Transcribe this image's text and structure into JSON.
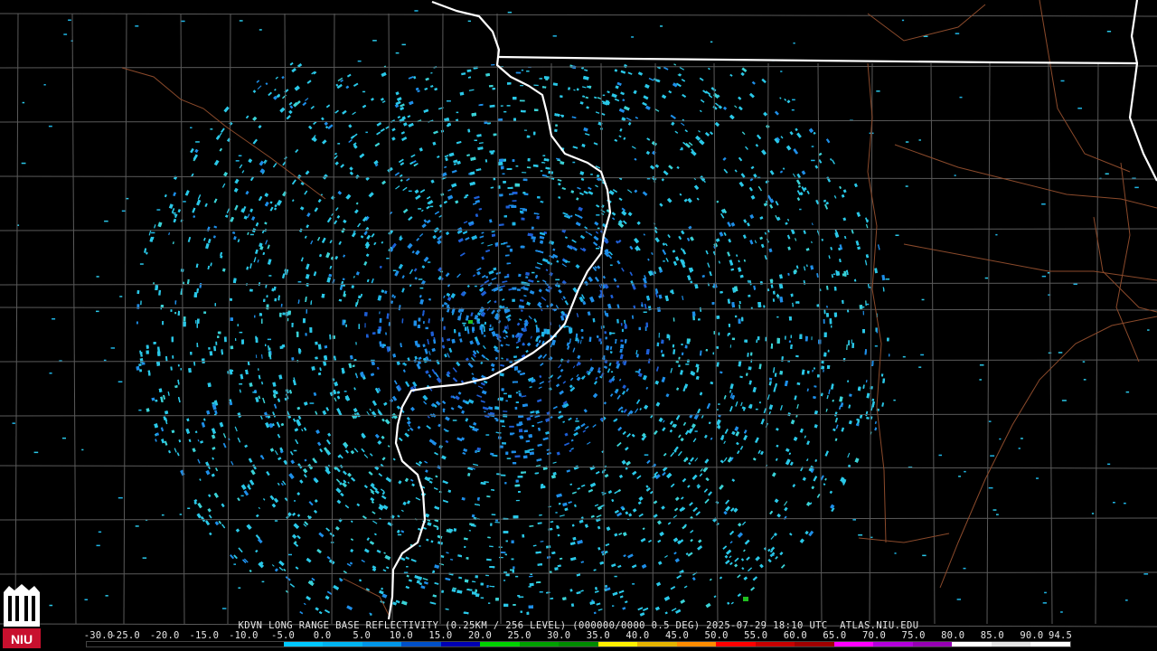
{
  "caption": {
    "station": "KDVN",
    "product": "LONG RANGE BASE REFLECTIVITY",
    "resolution": "(0.25KM / 256 LEVEL)",
    "volume": "(000000/0000",
    "elevation": "0.5 DEG)",
    "date": "2025-07-29",
    "time": "18:10 UTC",
    "source": "ATLAS.NIU.EDU"
  },
  "logo": {
    "text": "NIU",
    "name": "niu-logo"
  },
  "colorbar": {
    "ticks": [
      "-30.0",
      "-25.0",
      "-20.0",
      "-15.0",
      "-10.0",
      "-5.0",
      "0.0",
      "5.0",
      "10.0",
      "15.0",
      "20.0",
      "25.0",
      "30.0",
      "35.0",
      "40.0",
      "45.0",
      "50.0",
      "55.0",
      "60.0",
      "65.0",
      "70.0",
      "75.0",
      "80.0",
      "85.0",
      "90.0",
      "94.5"
    ],
    "colors": [
      "#000000",
      "#000000",
      "#000000",
      "#000000",
      "#000000",
      "#00c8ff",
      "#00b4f0",
      "#0096e8",
      "#0050c8",
      "#0000b4",
      "#00d200",
      "#00a000",
      "#008c00",
      "#fff000",
      "#e6b400",
      "#ff8c00",
      "#ff0000",
      "#c80000",
      "#a00000",
      "#ff00ff",
      "#b400dc",
      "#9600b4",
      "#ffffff",
      "#e6e6e6",
      "#ffffff"
    ]
  },
  "map": {
    "background": "#000000",
    "county_line_color": "#5a5a5a",
    "state_line_color": "#ffffff",
    "road_color": "#8b4a2b",
    "echo_colors": [
      "#2ac8e8",
      "#1fb6e6",
      "#1e8ee8",
      "#1e5ed6",
      "#3ad2d6"
    ],
    "radar_site": "KDVN"
  }
}
